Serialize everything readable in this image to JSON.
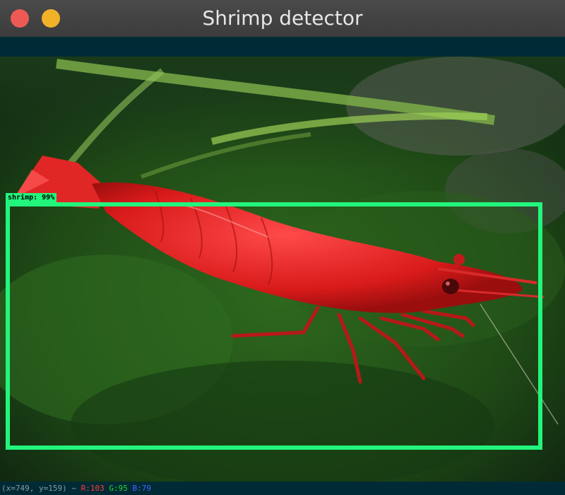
{
  "window": {
    "title": "Shrimp detector",
    "buttons": {
      "close_color": "#ed5a54",
      "minimize_color": "#f1b22a"
    }
  },
  "detection": {
    "label": "shrimp: 99%",
    "color": "#22f57c"
  },
  "status": {
    "position": "(x=749, y=159) ~",
    "r": "R:103",
    "g": "G:95",
    "b": "B:79"
  }
}
